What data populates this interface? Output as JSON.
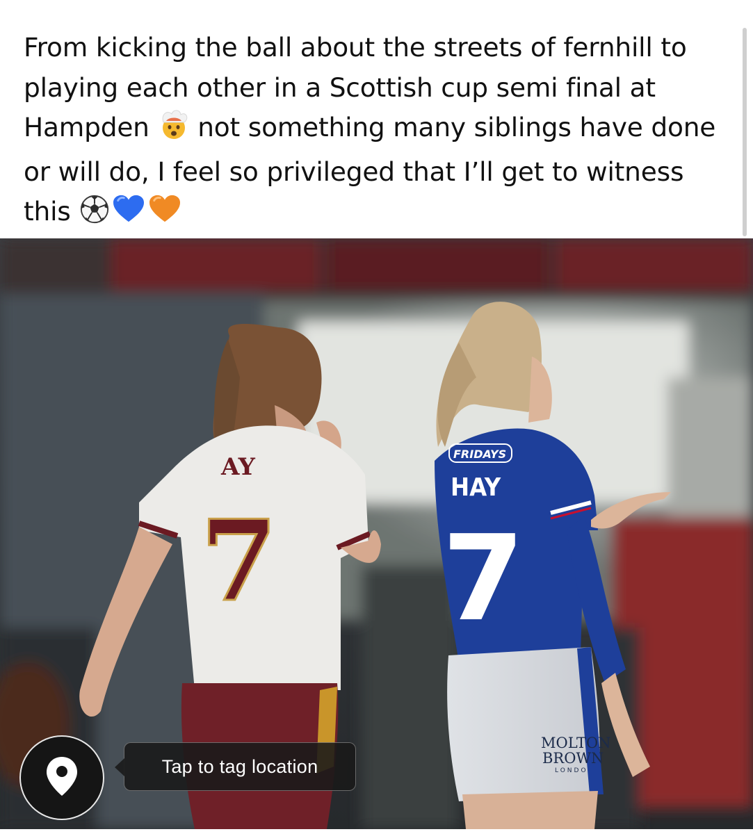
{
  "post": {
    "lines": [
      {
        "text": "From kicking the ball about the streets of fernhill to"
      },
      {
        "text": "playing each other in a Scottish cup semi final at"
      },
      {
        "text": "Hampden",
        "emoji": "exploding-head-emoji",
        "after": "not something many siblings have done"
      },
      {
        "text": "or will do, I feel so privileged that I’ll get to witness"
      },
      {
        "text": "this",
        "emojis": [
          "soccer-ball-emoji",
          "blue-heart-emoji",
          "orange-heart-emoji"
        ]
      }
    ]
  },
  "photo": {
    "left_player": {
      "shirt_name": "AY",
      "number": "7",
      "shirt_color": "#ecebe8",
      "trim_color": "#6b1a22"
    },
    "right_player": {
      "sponsor": "FRIDAYS",
      "shirt_name": "HAY",
      "number": "7",
      "shirt_color": "#1e3f9a",
      "shorts_text_1": "MOLTON",
      "shorts_text_2": "BROWN",
      "shorts_text_3": "LONDO"
    }
  },
  "location": {
    "icon": "location-pin-icon",
    "tooltip": "Tap to tag location"
  }
}
